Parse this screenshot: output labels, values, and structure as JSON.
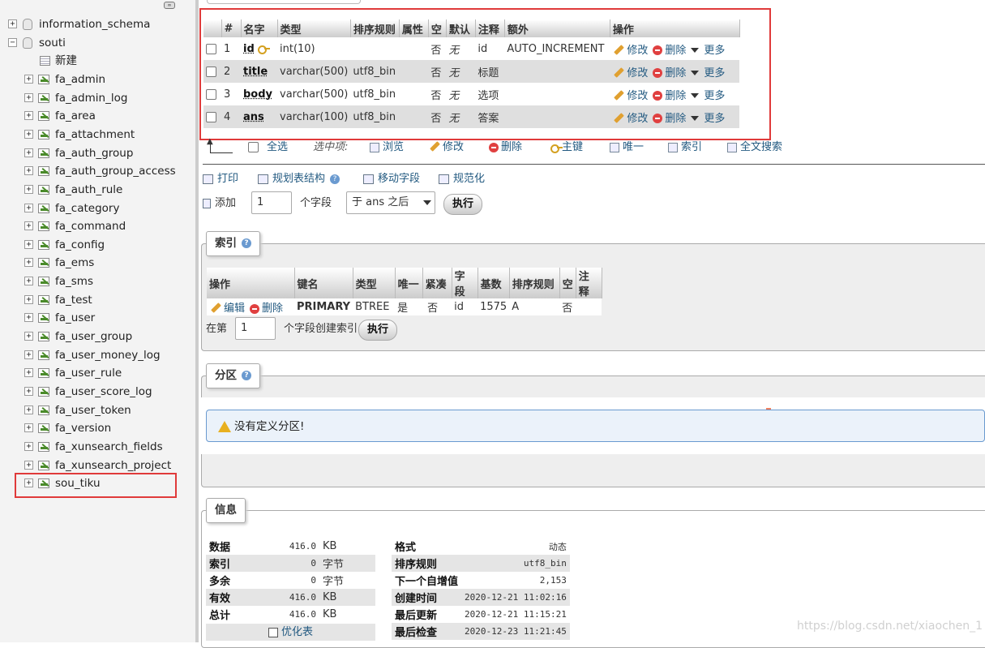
{
  "nav": {
    "handle_text": "∞",
    "items": [
      {
        "label": "information_schema",
        "kind": "db",
        "expander": "+"
      },
      {
        "label": "souti",
        "kind": "db",
        "expander": "−"
      },
      {
        "label": "新建",
        "kind": "new"
      },
      {
        "label": "fa_admin",
        "kind": "table",
        "expander": "+"
      },
      {
        "label": "fa_admin_log",
        "kind": "table",
        "expander": "+"
      },
      {
        "label": "fa_area",
        "kind": "table",
        "expander": "+"
      },
      {
        "label": "fa_attachment",
        "kind": "table",
        "expander": "+"
      },
      {
        "label": "fa_auth_group",
        "kind": "table",
        "expander": "+"
      },
      {
        "label": "fa_auth_group_access",
        "kind": "table",
        "expander": "+"
      },
      {
        "label": "fa_auth_rule",
        "kind": "table",
        "expander": "+"
      },
      {
        "label": "fa_category",
        "kind": "table",
        "expander": "+"
      },
      {
        "label": "fa_command",
        "kind": "table",
        "expander": "+"
      },
      {
        "label": "fa_config",
        "kind": "table",
        "expander": "+"
      },
      {
        "label": "fa_ems",
        "kind": "table",
        "expander": "+"
      },
      {
        "label": "fa_sms",
        "kind": "table",
        "expander": "+"
      },
      {
        "label": "fa_test",
        "kind": "table",
        "expander": "+"
      },
      {
        "label": "fa_user",
        "kind": "table",
        "expander": "+"
      },
      {
        "label": "fa_user_group",
        "kind": "table",
        "expander": "+"
      },
      {
        "label": "fa_user_money_log",
        "kind": "table",
        "expander": "+"
      },
      {
        "label": "fa_user_rule",
        "kind": "table",
        "expander": "+"
      },
      {
        "label": "fa_user_score_log",
        "kind": "table",
        "expander": "+"
      },
      {
        "label": "fa_user_token",
        "kind": "table",
        "expander": "+"
      },
      {
        "label": "fa_version",
        "kind": "table",
        "expander": "+"
      },
      {
        "label": "fa_xunsearch_fields",
        "kind": "table",
        "expander": "+"
      },
      {
        "label": "fa_xunsearch_project",
        "kind": "table",
        "expander": "+"
      },
      {
        "label": "sou_tiku",
        "kind": "table",
        "expander": "+",
        "selected": true
      }
    ]
  },
  "structure": {
    "headers": [
      "",
      "#",
      "名字",
      "类型",
      "排序规则",
      "属性",
      "空",
      "默认",
      "注释",
      "额外",
      "操作"
    ],
    "rows": [
      {
        "num": "1",
        "name": "id",
        "primary": true,
        "type": "int(10)",
        "collation": "",
        "attributes": "",
        "null": "否",
        "default": "无",
        "comment": "id",
        "extra": "AUTO_INCREMENT"
      },
      {
        "num": "2",
        "name": "title",
        "primary": false,
        "type": "varchar(500)",
        "collation": "utf8_bin",
        "attributes": "",
        "null": "否",
        "default": "无",
        "comment": "标题",
        "extra": ""
      },
      {
        "num": "3",
        "name": "body",
        "primary": false,
        "type": "varchar(500)",
        "collation": "utf8_bin",
        "attributes": "",
        "null": "否",
        "default": "无",
        "comment": "选项",
        "extra": ""
      },
      {
        "num": "4",
        "name": "ans",
        "primary": false,
        "type": "varchar(100)",
        "collation": "utf8_bin",
        "attributes": "",
        "null": "否",
        "default": "无",
        "comment": "答案",
        "extra": ""
      }
    ],
    "row_actions": {
      "edit": "修改",
      "drop": "删除",
      "more": "更多"
    }
  },
  "bulk": {
    "select_all": "全选",
    "with_selected": "选中项:",
    "browse": "浏览",
    "edit": "修改",
    "drop": "删除",
    "primary": "主键",
    "unique": "唯一",
    "index": "索引",
    "fulltext": "全文搜索"
  },
  "tools": {
    "print": "打印",
    "relation_view": "规划表结构",
    "move_columns": "移动字段",
    "normalize": "规范化",
    "add_label": "添加",
    "add_count": "1",
    "add_unit": "个字段",
    "add_position": "于 ans 之后",
    "go": "执行"
  },
  "indexes": {
    "legend": "索引",
    "headers": [
      "操作",
      "键名",
      "类型",
      "唯一",
      "紧凑",
      "字段",
      "基数",
      "排序规则",
      "空",
      "注释"
    ],
    "row": {
      "edit": "编辑",
      "drop": "删除",
      "keyname": "PRIMARY",
      "type": "BTREE",
      "unique": "是",
      "packed": "否",
      "column": "id",
      "cardinality": "1575",
      "collation": "A",
      "null": "否",
      "comment": ""
    },
    "create_prefix": "在第",
    "create_count": "1",
    "create_suffix": "个字段创建索引",
    "go": "执行"
  },
  "partitions": {
    "legend": "分区",
    "notice": "没有定义分区!"
  },
  "info": {
    "legend": "信息",
    "space": [
      {
        "label": "数据",
        "value": "416.0",
        "unit": "KB"
      },
      {
        "label": "索引",
        "value": "0",
        "unit": "字节"
      },
      {
        "label": "多余",
        "value": "0",
        "unit": "字节"
      },
      {
        "label": "有效",
        "value": "416.0",
        "unit": "KB"
      },
      {
        "label": "总计",
        "value": "416.0",
        "unit": "KB"
      }
    ],
    "optimize": "优化表",
    "stats": [
      {
        "label": "格式",
        "value": "动态"
      },
      {
        "label": "排序规则",
        "value": "utf8_bin"
      },
      {
        "label": "下一个自增值",
        "value": "2,153"
      },
      {
        "label": "创建时间",
        "value": "2020-12-21 11:02:16"
      },
      {
        "label": "最后更新",
        "value": "2020-12-21 11:15:21"
      },
      {
        "label": "最后检查",
        "value": "2020-12-23 11:21:45"
      }
    ]
  },
  "watermark": "https://blog.csdn.net/xiaochen_1"
}
